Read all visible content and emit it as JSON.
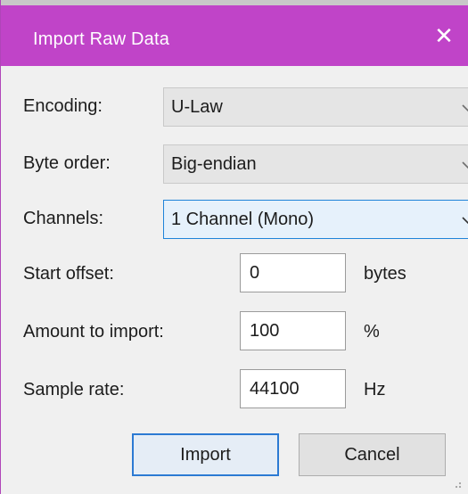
{
  "dialog": {
    "title": "Import Raw Data",
    "close_glyph": "✕"
  },
  "fields": {
    "encoding": {
      "label": "Encoding:",
      "value": "U-Law"
    },
    "byte_order": {
      "label": "Byte order:",
      "value": "Big-endian"
    },
    "channels": {
      "label": "Channels:",
      "value": "1 Channel (Mono)"
    },
    "start_offset": {
      "label": "Start offset:",
      "value": "0",
      "unit": "bytes"
    },
    "amount": {
      "label": "Amount to import:",
      "value": "100",
      "unit": "%"
    },
    "sample_rate": {
      "label": "Sample rate:",
      "value": "44100",
      "unit": "Hz"
    }
  },
  "buttons": {
    "import_label": "Import",
    "cancel_label": "Cancel"
  },
  "colors": {
    "titlebar": "#c044c8",
    "focus_border": "#1f83d9",
    "default_button_border": "#2c7ad3"
  },
  "icons": {
    "close": "close-icon",
    "dropdown": "chevron-down-icon",
    "resize": "resize-grip-icon"
  }
}
